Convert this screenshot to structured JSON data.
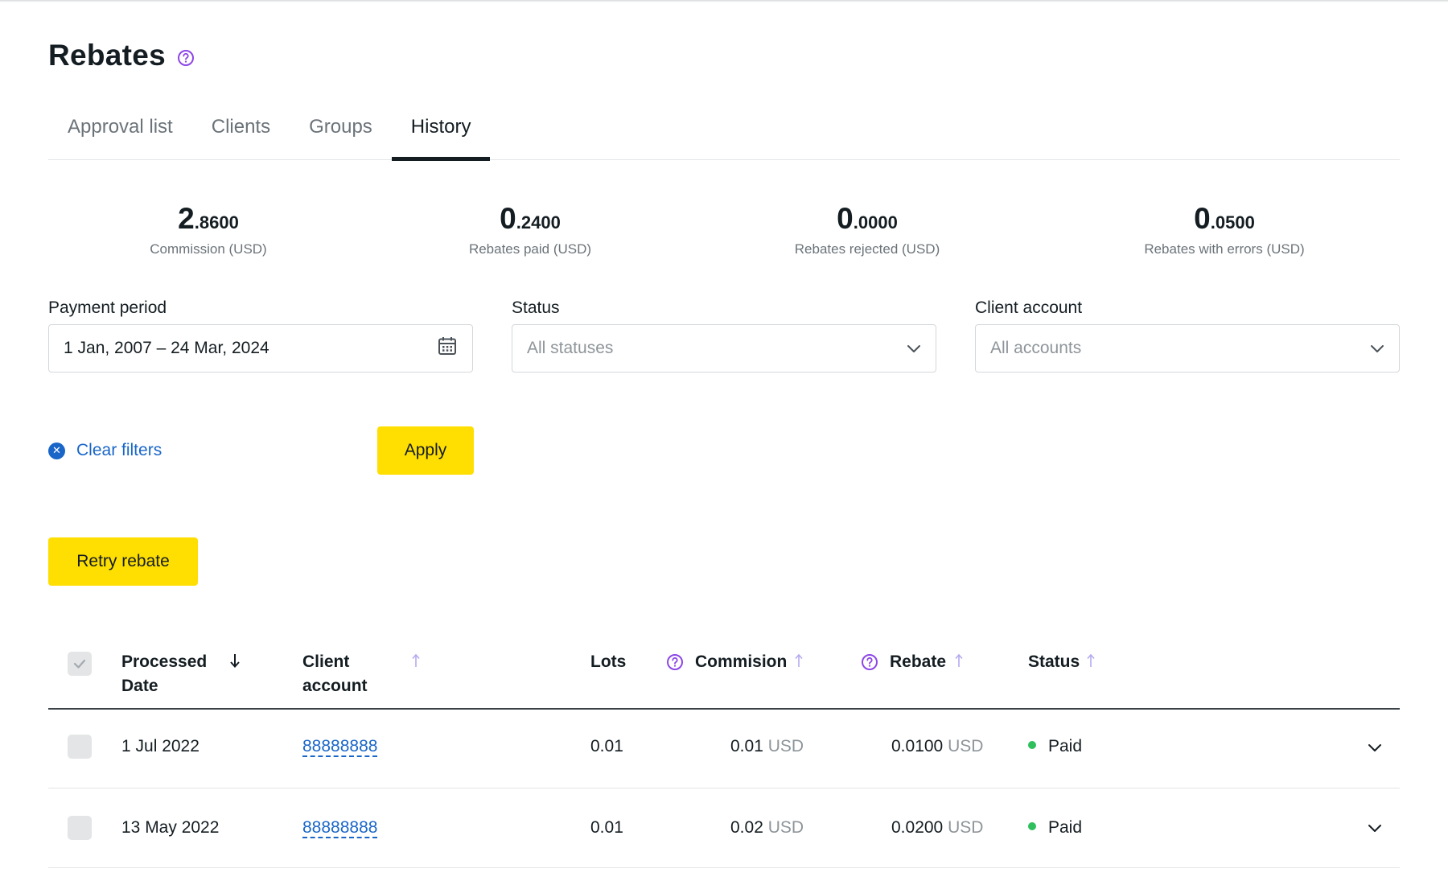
{
  "page": {
    "title": "Rebates"
  },
  "tabs": [
    {
      "label": "Approval list",
      "active": false
    },
    {
      "label": "Clients",
      "active": false
    },
    {
      "label": "Groups",
      "active": false
    },
    {
      "label": "History",
      "active": true
    }
  ],
  "stats": [
    {
      "int": "2",
      "dec": ".8600",
      "label": "Commission (USD)"
    },
    {
      "int": "0",
      "dec": ".2400",
      "label": "Rebates paid (USD)"
    },
    {
      "int": "0",
      "dec": ".0000",
      "label": "Rebates rejected (USD)"
    },
    {
      "int": "0",
      "dec": ".0500",
      "label": "Rebates with errors (USD)"
    }
  ],
  "filters": {
    "payment_period": {
      "label": "Payment period",
      "value": "1 Jan, 2007 – 24 Mar, 2024"
    },
    "status": {
      "label": "Status",
      "placeholder": "All statuses"
    },
    "client_account": {
      "label": "Client account",
      "placeholder": "All accounts"
    },
    "clear_label": "Clear filters",
    "apply_label": "Apply"
  },
  "retry_label": "Retry rebate",
  "table": {
    "columns": {
      "processed_date": [
        "Processed",
        "Date"
      ],
      "client_account": [
        "Client",
        "account"
      ],
      "lots": "Lots",
      "commission": "Commision",
      "rebate": "Rebate",
      "status": "Status"
    },
    "rows": [
      {
        "date": "1 Jul 2022",
        "account": "88888888",
        "lots": "0.01",
        "commission": "0.01",
        "commission_cur": "USD",
        "rebate": "0.0100",
        "rebate_cur": "USD",
        "status": "Paid"
      },
      {
        "date": "13 May 2022",
        "account": "88888888",
        "lots": "0.01",
        "commission": "0.02",
        "commission_cur": "USD",
        "rebate": "0.0200",
        "rebate_cur": "USD",
        "status": "Paid"
      }
    ]
  },
  "colors": {
    "accent_yellow": "#ffde02",
    "link_blue": "#1a66c8",
    "help_purple": "#8d47e6",
    "paid_green": "#2fbf5c"
  },
  "icons": [
    "help-icon",
    "calendar-icon",
    "chevron-down-icon",
    "clear-icon",
    "sort-arrow-icon",
    "check-icon"
  ]
}
